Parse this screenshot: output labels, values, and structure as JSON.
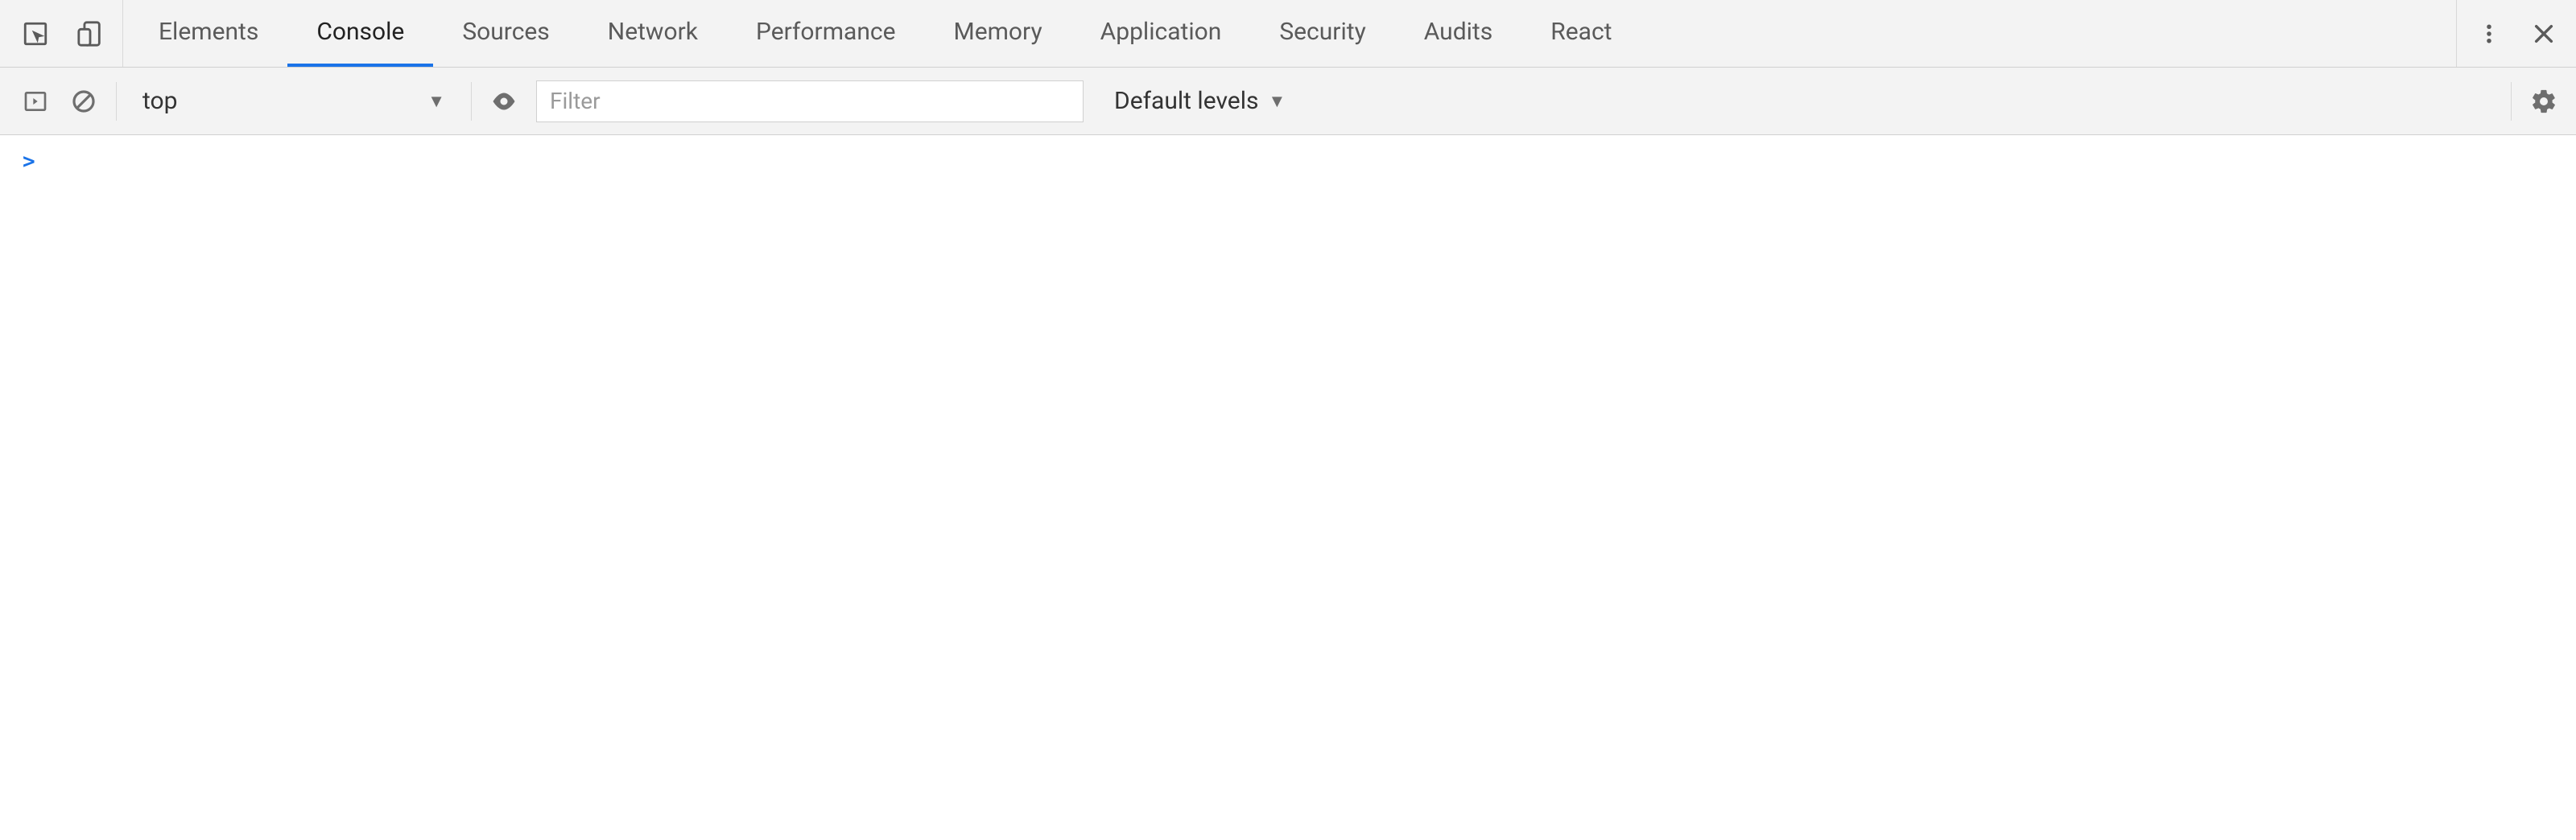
{
  "tabs": {
    "items": [
      {
        "label": "Elements",
        "active": false
      },
      {
        "label": "Console",
        "active": true
      },
      {
        "label": "Sources",
        "active": false
      },
      {
        "label": "Network",
        "active": false
      },
      {
        "label": "Performance",
        "active": false
      },
      {
        "label": "Memory",
        "active": false
      },
      {
        "label": "Application",
        "active": false
      },
      {
        "label": "Security",
        "active": false
      },
      {
        "label": "Audits",
        "active": false
      },
      {
        "label": "React",
        "active": false
      }
    ]
  },
  "toolbar": {
    "context": "top",
    "filter_placeholder": "Filter",
    "levels_label": "Default levels"
  },
  "console": {
    "prompt": ">"
  }
}
